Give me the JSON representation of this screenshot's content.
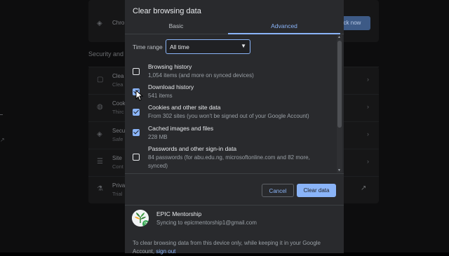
{
  "background": {
    "section_title": "Security and",
    "safety_button": "ck now",
    "top_row_label": "Chro",
    "rows": [
      {
        "icon": "trash-icon",
        "t1": "Clea",
        "t2": "Clea"
      },
      {
        "icon": "cookie-icon",
        "t1": "Cook",
        "t2": "Thirc"
      },
      {
        "icon": "shield-icon",
        "t1": "Secu",
        "t2": "Safe"
      },
      {
        "icon": "sliders-icon",
        "t1": "Site",
        "t2": "Cont"
      },
      {
        "icon": "flask-icon",
        "t1": "Priva",
        "t2": "Trial"
      }
    ]
  },
  "dialog": {
    "title": "Clear browsing data",
    "tabs": [
      "Basic",
      "Advanced"
    ],
    "active_tab": "Advanced",
    "time_range": {
      "label": "Time range",
      "value": "All time"
    },
    "items": [
      {
        "title": "Browsing history",
        "desc": "1,054 items (and more on synced devices)",
        "checked": false
      },
      {
        "title": "Download history",
        "desc": "541 items",
        "checked": true
      },
      {
        "title": "Cookies and other site data",
        "desc": "From 302 sites (you won't be signed out of your Google Account)",
        "checked": true
      },
      {
        "title": "Cached images and files",
        "desc": "228 MB",
        "checked": true
      },
      {
        "title": "Passwords and other sign-in data",
        "desc": "84 passwords (for abu.edu.ng, microsoftonline.com and 82 more, synced)",
        "checked": false
      }
    ],
    "buttons": {
      "cancel": "Cancel",
      "clear": "Clear data"
    },
    "account": {
      "name": "EPIC Mentorship",
      "sync_text": "Syncing to epicmentorship1@gmail.com"
    },
    "footer_text": "To clear browsing data from this device only, while keeping it in your Google Account,",
    "footer_link": "sign out"
  },
  "colors": {
    "accent": "#8ab4f8",
    "dialog_bg": "#292a2d",
    "text_primary": "#e8eaed",
    "text_secondary": "#9aa0a6"
  }
}
